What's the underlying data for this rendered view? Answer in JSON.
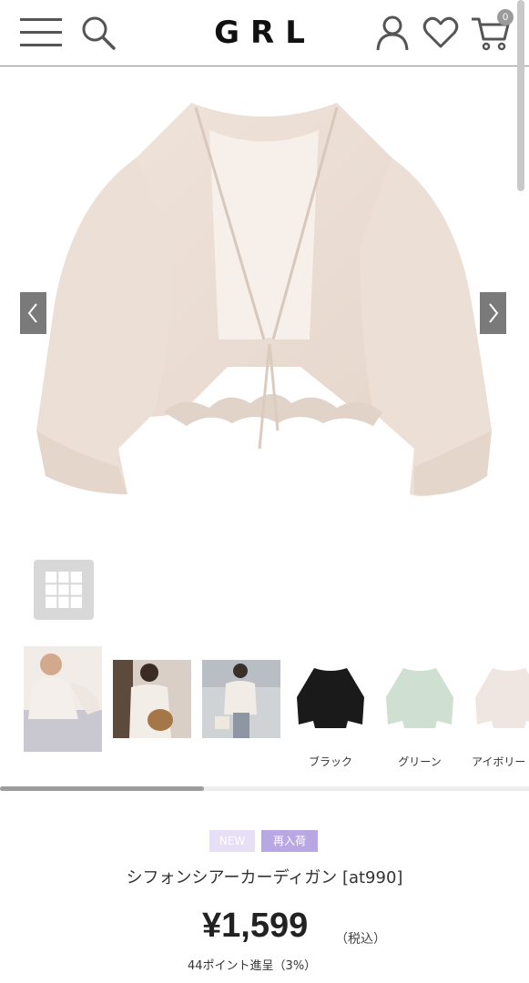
{
  "header": {
    "logo": "GRL",
    "cart_count": "0",
    "icons": [
      "menu-icon",
      "search-icon",
      "user-icon",
      "heart-icon",
      "cart-icon"
    ]
  },
  "gallery": {
    "prev_icon": "chevron-left-icon",
    "next_icon": "chevron-right-icon",
    "grid_icon": "grid-icon"
  },
  "thumbnails": [
    {
      "label": "",
      "kind": "model-photo"
    },
    {
      "label": "",
      "kind": "model-photo"
    },
    {
      "label": "",
      "kind": "model-photo"
    },
    {
      "label": "ブラック",
      "kind": "color-swatch",
      "color": "#1a1a1a"
    },
    {
      "label": "グリーン",
      "kind": "color-swatch",
      "color": "#cfe0d2"
    },
    {
      "label": "アイボリー",
      "kind": "color-swatch",
      "color": "#efe6e1"
    }
  ],
  "product": {
    "badges": {
      "new": "NEW",
      "restock": "再入荷"
    },
    "name": "シフォンシアーカーディガン [at990]",
    "price": "¥1,599",
    "tax_note": "（税込）",
    "points": "44ポイント進呈（3%）"
  },
  "colors": {
    "restock_badge": "#b8a7e3",
    "new_badge": "#e6dff5",
    "arrow_bg": "#7a7a7a"
  }
}
